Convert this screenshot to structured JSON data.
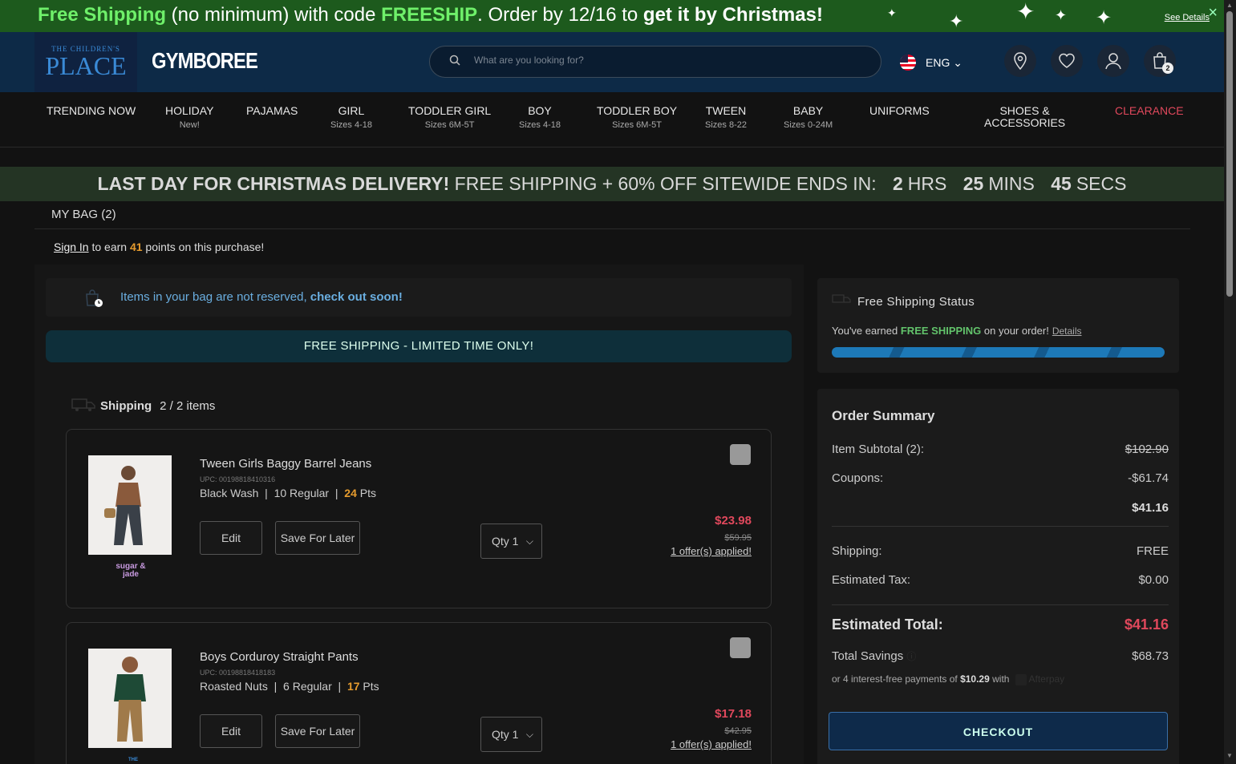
{
  "promo": {
    "part1": "Free Shipping",
    "part2": " (no minimum) with code ",
    "code": "FREESHIP",
    "part3": ". Order by 12/16 to ",
    "part4": "get it by Christmas!",
    "see_details": "See Details",
    "close": "×"
  },
  "header": {
    "logo1_small": "THE CHILDREN'S",
    "logo1_big": "PLACE",
    "logo2": "GYMBOREE",
    "search_placeholder": "What are you looking for?",
    "lang": "ENG",
    "bag_count": "2"
  },
  "nav": [
    {
      "label": "TRENDING NOW",
      "sub": ""
    },
    {
      "label": "HOLIDAY",
      "sub": "New!"
    },
    {
      "label": "PAJAMAS",
      "sub": ""
    },
    {
      "label": "GIRL",
      "sub": "Sizes 4-18"
    },
    {
      "label": "TODDLER GIRL",
      "sub": "Sizes 6M-5T"
    },
    {
      "label": "BOY",
      "sub": "Sizes 4-18"
    },
    {
      "label": "TODDLER BOY",
      "sub": "Sizes 6M-5T"
    },
    {
      "label": "TWEEN",
      "sub": "Sizes 8-22"
    },
    {
      "label": "BABY",
      "sub": "Sizes 0-24M"
    },
    {
      "label": "UNIFORMS",
      "sub": ""
    },
    {
      "label": "SHOES &",
      "sub": "ACCESSORIES"
    },
    {
      "label": "CLEARANCE",
      "sub": ""
    }
  ],
  "countdown": {
    "bold": "LAST DAY FOR CHRISTMAS DELIVERY!",
    "rest": " FREE SHIPPING + 60% OFF SITEWIDE ENDS IN:",
    "hrs": "2",
    "hrs_label": "HRS",
    "mins": "25",
    "mins_label": "MINS",
    "secs": "45",
    "secs_label": "SECS"
  },
  "bag": {
    "title": "MY BAG (2)",
    "sign_in": "Sign In",
    "earn_pre": " to earn ",
    "points": "41",
    "earn_post": " points on this purchase!",
    "notice_pre": "Items in your bag are not reserved, ",
    "notice_bold": "check out soon!",
    "free_banner": "FREE SHIPPING - LIMITED TIME ONLY!",
    "shipping_label": "Shipping",
    "shipping_count": "2 / 2 items"
  },
  "items": [
    {
      "name": "Tween Girls Baggy Barrel Jeans",
      "upc": "UPC: 00198818410316",
      "color": "Black Wash",
      "size": "10 Regular",
      "pts": "24",
      "pts_label": "Pts",
      "edit": "Edit",
      "save": "Save For Later",
      "qty": "Qty 1",
      "price": "$23.98",
      "orig": "$59.95",
      "offers": "1 offer(s) applied!",
      "brand": "sugar & jade"
    },
    {
      "name": "Boys Corduroy Straight Pants",
      "upc": "UPC: 00198818418183",
      "color": "Roasted Nuts",
      "size": "6 Regular",
      "pts": "17",
      "pts_label": "Pts",
      "edit": "Edit",
      "save": "Save For Later",
      "qty": "Qty 1",
      "price": "$17.18",
      "orig": "$42.95",
      "offers": "1 offer(s) applied!",
      "brand": "THE CHILDREN'S"
    }
  ],
  "shipping_status": {
    "title": "Free Shipping Status",
    "text_pre": "You've earned ",
    "text_bold": "FREE SHIPPING",
    "text_post": " on your order!",
    "details": "Details",
    "progress": 1.0
  },
  "summary": {
    "title": "Order Summary",
    "subtotal_label": "Item Subtotal (2):",
    "subtotal": "$102.90",
    "coupons_label": "Coupons:",
    "coupons": "-$61.74",
    "net": "$41.16",
    "shipping_label": "Shipping:",
    "shipping": "FREE",
    "tax_label": "Estimated Tax:",
    "tax": "$0.00",
    "total_label": "Estimated Total:",
    "total": "$41.16",
    "savings_label": "Total Savings",
    "savings": "$68.73",
    "afterpay_pre": "or 4 interest-free payments of ",
    "afterpay_amt": "$10.29",
    "afterpay_post": " with",
    "afterpay_brand": "Afterpay",
    "checkout": "CHECKOUT"
  }
}
